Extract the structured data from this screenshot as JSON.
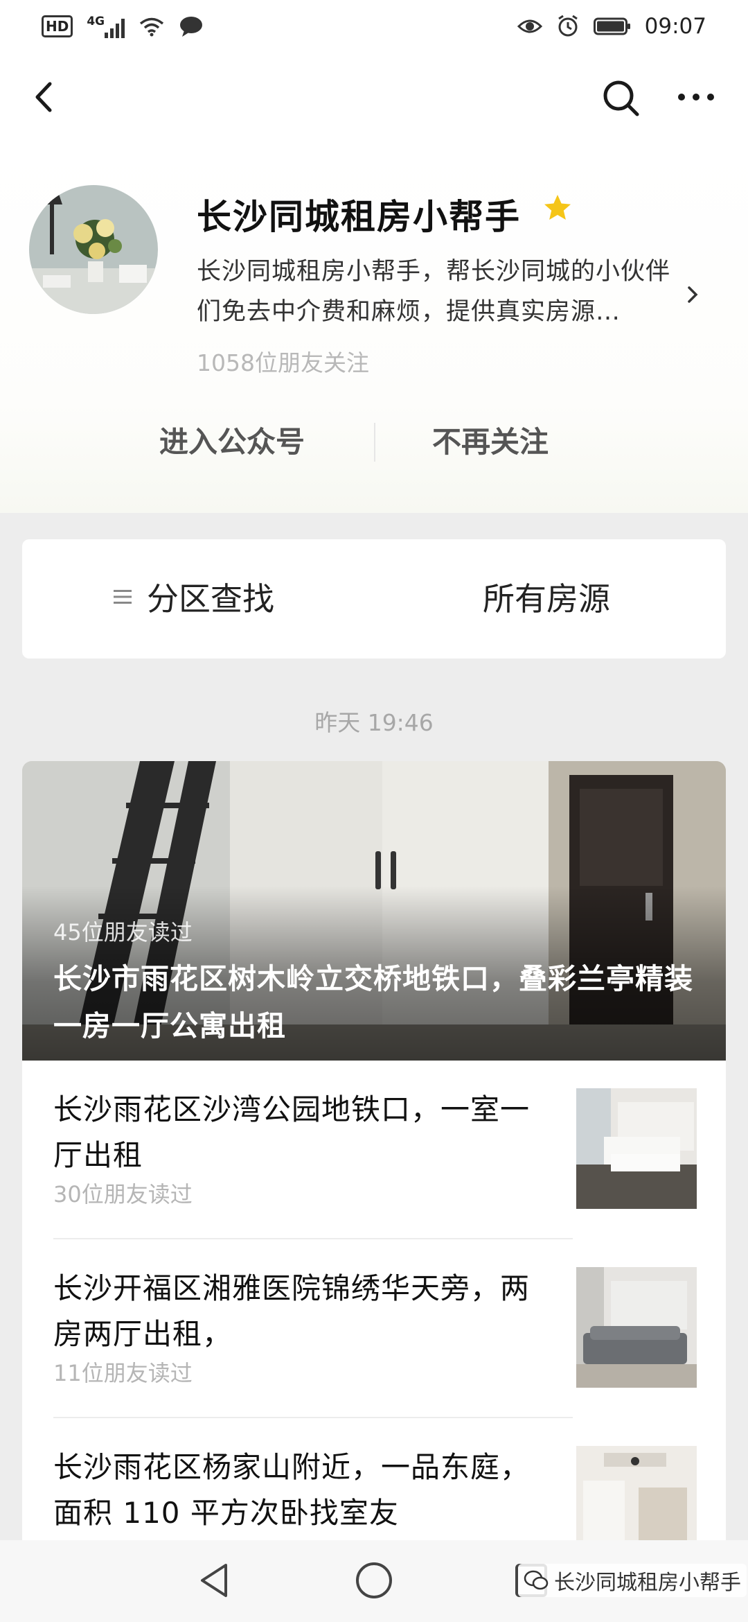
{
  "status_bar": {
    "hd_label": "HD",
    "network_label": "4G",
    "time": "09:07"
  },
  "topbar": {
    "back_icon": "chevron-left-icon",
    "search_icon": "search-icon",
    "more_icon": "more-horizontal-icon"
  },
  "account": {
    "name": "长沙同城租房小帮手",
    "verified_icon": "star-icon",
    "description": "长沙同城租房小帮手，帮长沙同城的小伙伴们免去中介费和麻烦，提供真实房源…",
    "followers": "1058位朋友关注",
    "enter_label": "进入公众号",
    "unfollow_label": "不再关注"
  },
  "menu": {
    "district_label": "分区查找",
    "all_label": "所有房源"
  },
  "feed": {
    "timestamp": "昨天 19:46",
    "hero": {
      "reads": "45位朋友读过",
      "title": "长沙市雨花区树木岭立交桥地铁口，叠彩兰亭精装一房一厅公寓出租"
    },
    "articles": [
      {
        "title": "长沙雨花区沙湾公园地铁口，一室一厅出租",
        "reads": "30位朋友读过"
      },
      {
        "title": "长沙开福区湘雅医院锦绣华天旁，两房两厅出租，",
        "reads": "11位朋友读过"
      },
      {
        "title": "长沙雨花区杨家山附近，一品东庭，面积 110 平方次卧找室友",
        "reads": ""
      }
    ]
  },
  "watermark": {
    "text": "长沙同城租房小帮手"
  },
  "colors": {
    "star": "#f5c518",
    "muted_text": "#b5b5b5",
    "background": "#ededed"
  }
}
